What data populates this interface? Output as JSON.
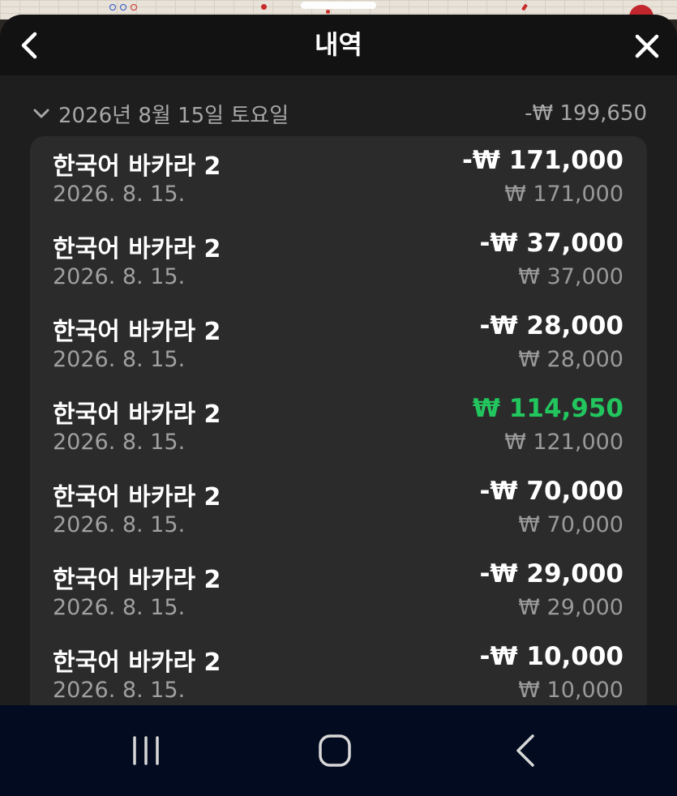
{
  "header": {
    "title": "내역"
  },
  "group": {
    "date": "2026년 8월 15일 토요일",
    "total": "-₩ 199,650"
  },
  "transactions": [
    {
      "name": "한국어 바카라 2",
      "date": "2026. 8. 15.",
      "amount": "-₩ 171,000",
      "bet": "₩ 171,000",
      "win": false
    },
    {
      "name": "한국어 바카라 2",
      "date": "2026. 8. 15.",
      "amount": "-₩ 37,000",
      "bet": "₩ 37,000",
      "win": false
    },
    {
      "name": "한국어 바카라 2",
      "date": "2026. 8. 15.",
      "amount": "-₩ 28,000",
      "bet": "₩ 28,000",
      "win": false
    },
    {
      "name": "한국어 바카라 2",
      "date": "2026. 8. 15.",
      "amount": "₩ 114,950",
      "bet": "₩ 121,000",
      "win": true
    },
    {
      "name": "한국어 바카라 2",
      "date": "2026. 8. 15.",
      "amount": "-₩ 70,000",
      "bet": "₩ 70,000",
      "win": false
    },
    {
      "name": "한국어 바카라 2",
      "date": "2026. 8. 15.",
      "amount": "-₩ 29,000",
      "bet": "₩ 29,000",
      "win": false
    },
    {
      "name": "한국어 바카라 2",
      "date": "2026. 8. 15.",
      "amount": "-₩ 10,000",
      "bet": "₩ 10,000",
      "win": false
    }
  ],
  "icons": {
    "back": "chevron-left-icon",
    "close": "close-icon",
    "expand": "chevron-down-icon",
    "nav_recents": "recent-apps-icon",
    "nav_home": "home-icon",
    "nav_back": "back-arrow-icon"
  },
  "colors": {
    "win": "#22c55e",
    "header_bg": "#121212",
    "card_bg": "#2b2b2b",
    "navbar_bg": "#020b1f"
  }
}
